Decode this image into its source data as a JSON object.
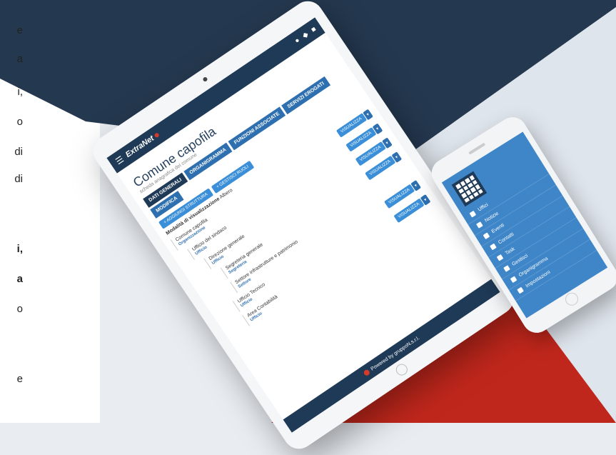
{
  "left_fragments": [
    {
      "text": "e",
      "bold": false
    },
    {
      "text": "a",
      "bold": false
    },
    {
      "text": "i,",
      "bold": false
    },
    {
      "text": "o",
      "bold": false
    },
    {
      "text": "di",
      "bold": false
    },
    {
      "text": "di",
      "bold": false
    },
    {
      "text": "i,",
      "bold": true
    },
    {
      "text": "a",
      "bold": true
    },
    {
      "text": "o",
      "bold": false
    },
    {
      "text": "e",
      "bold": false
    }
  ],
  "tablet": {
    "brand": "ExtraNet",
    "page_title": "Comune capofila",
    "page_subtitle": "scheda anagrafica del comune",
    "tabs": [
      "DATI GENERALI",
      "ORGANIGRAMMA",
      "FUNZIONI ASSOCIATE",
      "SERVIZI EROGATI",
      "MODIFICA"
    ],
    "buttons": [
      "+ AGGIUNGI STRUTTURA",
      "+ GESTISCI RUOLI"
    ],
    "filter_label": "Modalità di visualizzazione",
    "filter_value": "Albero",
    "tree": [
      {
        "name": "Comune capofila",
        "kind": "Organizzazione",
        "action": "VISUALIZZA"
      },
      {
        "name": "Ufficio del sindaco",
        "kind": "Ufficio",
        "action": "VISUALIZZA"
      },
      {
        "name": "Direzione generale",
        "kind": "Ufficio",
        "action": "VISUALIZZA"
      },
      {
        "name": "Segreteria generale",
        "kind": "Segreteria",
        "action": "VISUALIZZA"
      },
      {
        "name": "Settore infrastrutture e patrimonio",
        "kind": "Settore",
        "action": ""
      },
      {
        "name": "Ufficio Tecnico",
        "kind": "Ufficio",
        "action": "VISUALIZZA"
      },
      {
        "name": "Area Contabilità",
        "kind": "Ufficio",
        "action": "VISUALIZZA"
      }
    ],
    "footer": "Powered by gruppoN.s.r.l."
  },
  "phone": {
    "menu": [
      "Uffici",
      "Notizie",
      "Eventi",
      "Contatti",
      "Task",
      "Gestisci",
      "Organigramma",
      "Impostazioni"
    ]
  }
}
